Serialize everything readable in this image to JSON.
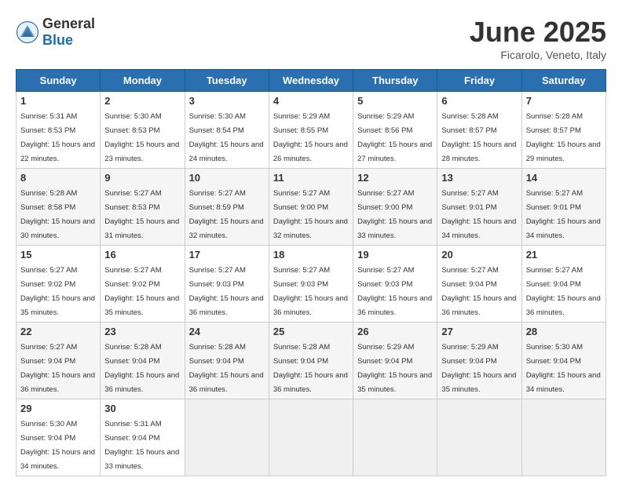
{
  "logo": {
    "general": "General",
    "blue": "Blue"
  },
  "title": "June 2025",
  "subtitle": "Ficarolo, Veneto, Italy",
  "weekdays": [
    "Sunday",
    "Monday",
    "Tuesday",
    "Wednesday",
    "Thursday",
    "Friday",
    "Saturday"
  ],
  "weeks": [
    [
      {
        "day": "1",
        "sunrise": "Sunrise: 5:31 AM",
        "sunset": "Sunset: 8:53 PM",
        "daylight": "Daylight: 15 hours and 22 minutes."
      },
      {
        "day": "2",
        "sunrise": "Sunrise: 5:30 AM",
        "sunset": "Sunset: 8:53 PM",
        "daylight": "Daylight: 15 hours and 23 minutes."
      },
      {
        "day": "3",
        "sunrise": "Sunrise: 5:30 AM",
        "sunset": "Sunset: 8:54 PM",
        "daylight": "Daylight: 15 hours and 24 minutes."
      },
      {
        "day": "4",
        "sunrise": "Sunrise: 5:29 AM",
        "sunset": "Sunset: 8:55 PM",
        "daylight": "Daylight: 15 hours and 26 minutes."
      },
      {
        "day": "5",
        "sunrise": "Sunrise: 5:29 AM",
        "sunset": "Sunset: 8:56 PM",
        "daylight": "Daylight: 15 hours and 27 minutes."
      },
      {
        "day": "6",
        "sunrise": "Sunrise: 5:28 AM",
        "sunset": "Sunset: 8:57 PM",
        "daylight": "Daylight: 15 hours and 28 minutes."
      },
      {
        "day": "7",
        "sunrise": "Sunrise: 5:28 AM",
        "sunset": "Sunset: 8:57 PM",
        "daylight": "Daylight: 15 hours and 29 minutes."
      }
    ],
    [
      {
        "day": "8",
        "sunrise": "Sunrise: 5:28 AM",
        "sunset": "Sunset: 8:58 PM",
        "daylight": "Daylight: 15 hours and 30 minutes."
      },
      {
        "day": "9",
        "sunrise": "Sunrise: 5:27 AM",
        "sunset": "Sunset: 8:53 PM",
        "daylight": "Daylight: 15 hours and 31 minutes."
      },
      {
        "day": "10",
        "sunrise": "Sunrise: 5:27 AM",
        "sunset": "Sunset: 8:59 PM",
        "daylight": "Daylight: 15 hours and 32 minutes."
      },
      {
        "day": "11",
        "sunrise": "Sunrise: 5:27 AM",
        "sunset": "Sunset: 9:00 PM",
        "daylight": "Daylight: 15 hours and 32 minutes."
      },
      {
        "day": "12",
        "sunrise": "Sunrise: 5:27 AM",
        "sunset": "Sunset: 9:00 PM",
        "daylight": "Daylight: 15 hours and 33 minutes."
      },
      {
        "day": "13",
        "sunrise": "Sunrise: 5:27 AM",
        "sunset": "Sunset: 9:01 PM",
        "daylight": "Daylight: 15 hours and 34 minutes."
      },
      {
        "day": "14",
        "sunrise": "Sunrise: 5:27 AM",
        "sunset": "Sunset: 9:01 PM",
        "daylight": "Daylight: 15 hours and 34 minutes."
      }
    ],
    [
      {
        "day": "15",
        "sunrise": "Sunrise: 5:27 AM",
        "sunset": "Sunset: 9:02 PM",
        "daylight": "Daylight: 15 hours and 35 minutes."
      },
      {
        "day": "16",
        "sunrise": "Sunrise: 5:27 AM",
        "sunset": "Sunset: 9:02 PM",
        "daylight": "Daylight: 15 hours and 35 minutes."
      },
      {
        "day": "17",
        "sunrise": "Sunrise: 5:27 AM",
        "sunset": "Sunset: 9:03 PM",
        "daylight": "Daylight: 15 hours and 36 minutes."
      },
      {
        "day": "18",
        "sunrise": "Sunrise: 5:27 AM",
        "sunset": "Sunset: 9:03 PM",
        "daylight": "Daylight: 15 hours and 36 minutes."
      },
      {
        "day": "19",
        "sunrise": "Sunrise: 5:27 AM",
        "sunset": "Sunset: 9:03 PM",
        "daylight": "Daylight: 15 hours and 36 minutes."
      },
      {
        "day": "20",
        "sunrise": "Sunrise: 5:27 AM",
        "sunset": "Sunset: 9:04 PM",
        "daylight": "Daylight: 15 hours and 36 minutes."
      },
      {
        "day": "21",
        "sunrise": "Sunrise: 5:27 AM",
        "sunset": "Sunset: 9:04 PM",
        "daylight": "Daylight: 15 hours and 36 minutes."
      }
    ],
    [
      {
        "day": "22",
        "sunrise": "Sunrise: 5:27 AM",
        "sunset": "Sunset: 9:04 PM",
        "daylight": "Daylight: 15 hours and 36 minutes."
      },
      {
        "day": "23",
        "sunrise": "Sunrise: 5:28 AM",
        "sunset": "Sunset: 9:04 PM",
        "daylight": "Daylight: 15 hours and 36 minutes."
      },
      {
        "day": "24",
        "sunrise": "Sunrise: 5:28 AM",
        "sunset": "Sunset: 9:04 PM",
        "daylight": "Daylight: 15 hours and 36 minutes."
      },
      {
        "day": "25",
        "sunrise": "Sunrise: 5:28 AM",
        "sunset": "Sunset: 9:04 PM",
        "daylight": "Daylight: 15 hours and 36 minutes."
      },
      {
        "day": "26",
        "sunrise": "Sunrise: 5:29 AM",
        "sunset": "Sunset: 9:04 PM",
        "daylight": "Daylight: 15 hours and 35 minutes."
      },
      {
        "day": "27",
        "sunrise": "Sunrise: 5:29 AM",
        "sunset": "Sunset: 9:04 PM",
        "daylight": "Daylight: 15 hours and 35 minutes."
      },
      {
        "day": "28",
        "sunrise": "Sunrise: 5:30 AM",
        "sunset": "Sunset: 9:04 PM",
        "daylight": "Daylight: 15 hours and 34 minutes."
      }
    ],
    [
      {
        "day": "29",
        "sunrise": "Sunrise: 5:30 AM",
        "sunset": "Sunset: 9:04 PM",
        "daylight": "Daylight: 15 hours and 34 minutes."
      },
      {
        "day": "30",
        "sunrise": "Sunrise: 5:31 AM",
        "sunset": "Sunset: 9:04 PM",
        "daylight": "Daylight: 15 hours and 33 minutes."
      },
      null,
      null,
      null,
      null,
      null
    ]
  ]
}
